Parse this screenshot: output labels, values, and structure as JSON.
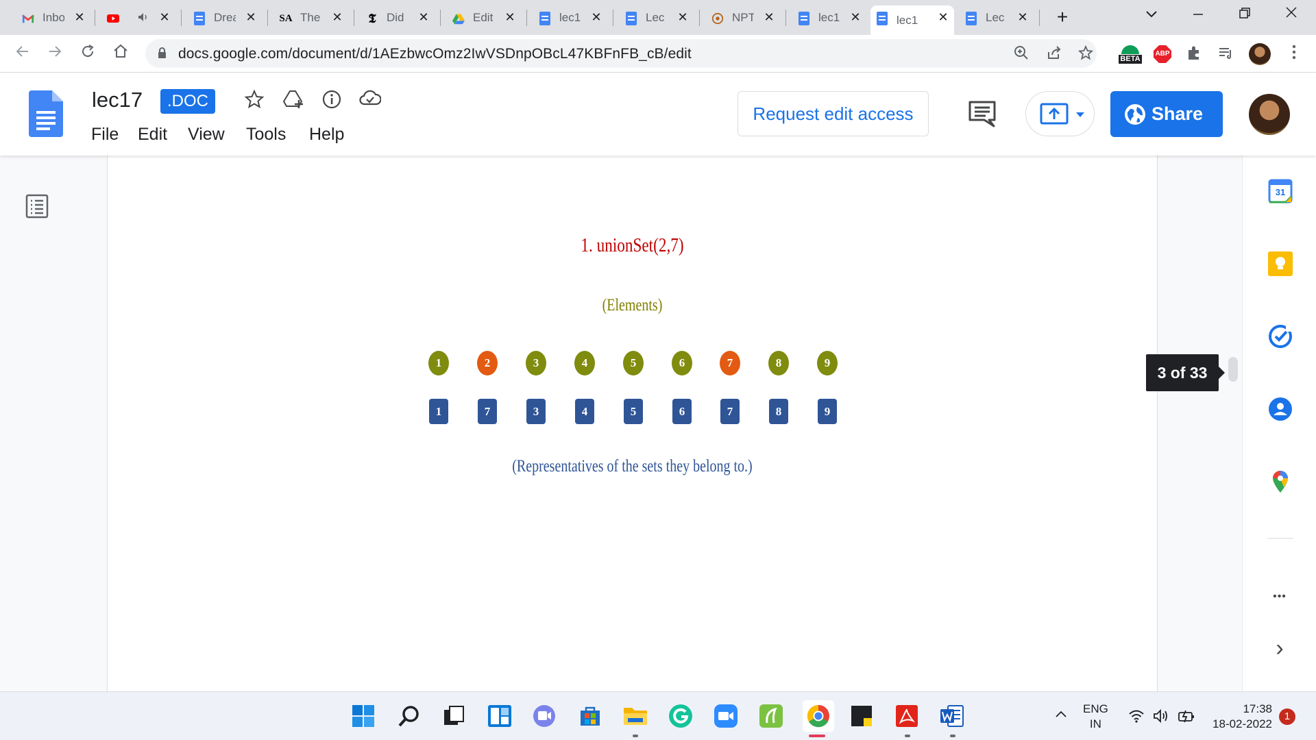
{
  "browser": {
    "tabs": [
      {
        "title": "Inbox",
        "icon": "gmail-icon",
        "active": false
      },
      {
        "title": "",
        "icon": "youtube-icon",
        "muted": true,
        "active": false
      },
      {
        "title": "Dream",
        "icon": "docs-icon",
        "active": false
      },
      {
        "title": "The",
        "icon": "sa-icon",
        "active": false
      },
      {
        "title": "Did",
        "icon": "nyt-icon",
        "active": false
      },
      {
        "title": "Edit",
        "icon": "drive-icon",
        "active": false
      },
      {
        "title": "lec1",
        "icon": "docs-icon",
        "active": false
      },
      {
        "title": "Lec",
        "icon": "docs-icon",
        "active": false
      },
      {
        "title": "NPT",
        "icon": "nptel-icon",
        "active": false
      },
      {
        "title": "lec1",
        "icon": "docs-icon",
        "active": false
      },
      {
        "title": "lec1",
        "icon": "docs-icon",
        "active": true
      },
      {
        "title": "Lec",
        "icon": "docs-icon",
        "active": false
      }
    ],
    "sa_glyph": "SA",
    "nyt_glyph": "𝕿",
    "close_glyph": "✕",
    "new_tab_glyph": "+",
    "url": "docs.google.com/document/d/1AEzbwcOmz2IwVSDnpOBcL47KBFnFB_cB/edit",
    "beta_label": "BETA",
    "abp_label": "ABP"
  },
  "docs": {
    "title": "lec17",
    "badge": ".DOC",
    "menu": [
      "File",
      "Edit",
      "View",
      "Tools",
      "Help"
    ],
    "request_edit_label": "Request edit access",
    "share_label": "Share",
    "page_indicator": "3 of 33",
    "accent_color": "#1a73e8"
  },
  "slide": {
    "title": "1. unionSet(2,7)",
    "elements_caption": "(Elements)",
    "representatives_caption": "(Representatives of the sets they belong to.)",
    "elements": [
      {
        "label": "1",
        "color": "#7f8c0e"
      },
      {
        "label": "2",
        "color": "#e35a12"
      },
      {
        "label": "3",
        "color": "#7f8c0e"
      },
      {
        "label": "4",
        "color": "#7f8c0e"
      },
      {
        "label": "5",
        "color": "#7f8c0e"
      },
      {
        "label": "6",
        "color": "#7f8c0e"
      },
      {
        "label": "7",
        "color": "#e35a12"
      },
      {
        "label": "8",
        "color": "#7f8c0e"
      },
      {
        "label": "9",
        "color": "#7f8c0e"
      }
    ],
    "representatives": [
      "1",
      "7",
      "3",
      "4",
      "5",
      "6",
      "7",
      "8",
      "9"
    ]
  },
  "side_panel": {
    "calendar_label": "31",
    "more_glyph": "•••",
    "expand_glyph": "›"
  },
  "taskbar": {
    "lang_line1": "ENG",
    "lang_line2": "IN",
    "time": "17:38",
    "date": "18-02-2022",
    "notification_count": "1"
  }
}
